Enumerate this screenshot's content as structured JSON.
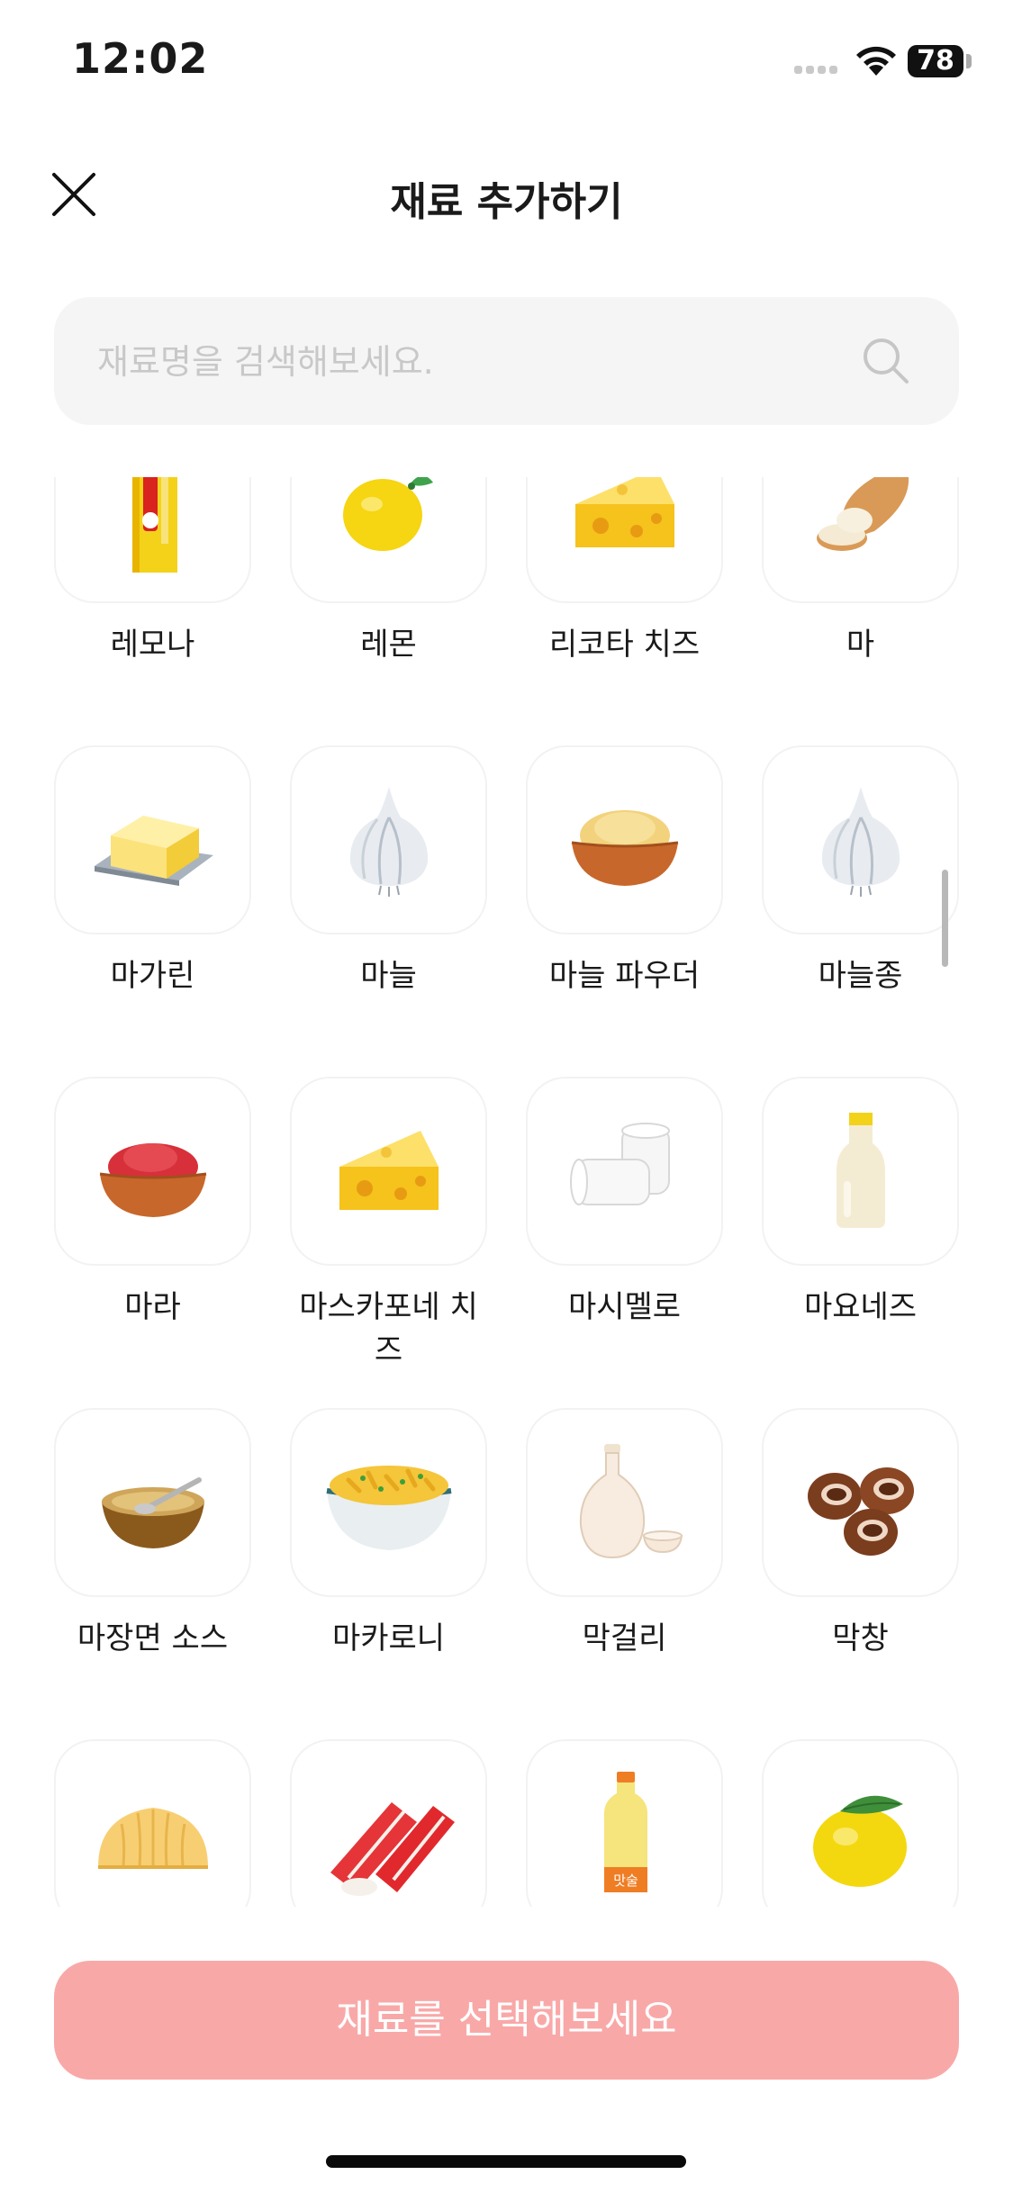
{
  "status_bar": {
    "time": "12:02",
    "battery": "78"
  },
  "header": {
    "title": "재료 추가하기"
  },
  "search": {
    "placeholder": "재료명을 검색해보세요."
  },
  "items": [
    {
      "label": "레모나",
      "icon": "lemona-packet-icon"
    },
    {
      "label": "레몬",
      "icon": "lemon-icon"
    },
    {
      "label": "리코타 치즈",
      "icon": "cheese-icon"
    },
    {
      "label": "마",
      "icon": "yam-icon"
    },
    {
      "label": "마가린",
      "icon": "margarine-icon"
    },
    {
      "label": "마늘",
      "icon": "garlic-icon"
    },
    {
      "label": "마늘 파우더",
      "icon": "powder-bowl-icon"
    },
    {
      "label": "마늘종",
      "icon": "garlic-icon"
    },
    {
      "label": "마라",
      "icon": "red-powder-bowl-icon"
    },
    {
      "label": "마스카포네 치즈",
      "icon": "cheese-icon"
    },
    {
      "label": "마시멜로",
      "icon": "marshmallow-icon"
    },
    {
      "label": "마요네즈",
      "icon": "mayonnaise-bottle-icon"
    },
    {
      "label": "마장면 소스",
      "icon": "sauce-bowl-icon"
    },
    {
      "label": "마카로니",
      "icon": "macaroni-bowl-icon"
    },
    {
      "label": "막걸리",
      "icon": "makgeolli-icon"
    },
    {
      "label": "막창",
      "icon": "makchang-icon"
    },
    {
      "label": "",
      "icon": "dumpling-icon"
    },
    {
      "label": "",
      "icon": "crab-stick-icon"
    },
    {
      "label": "",
      "icon": "mirin-bottle-icon",
      "bottle_text": "맛술"
    },
    {
      "label": "",
      "icon": "mango-icon"
    }
  ],
  "cta": {
    "label": "재료를 선택해보세요"
  },
  "colors": {
    "cta_bg": "#f9a8a8",
    "tile_border": "#f2f2f2",
    "search_bg": "#f5f5f5"
  }
}
